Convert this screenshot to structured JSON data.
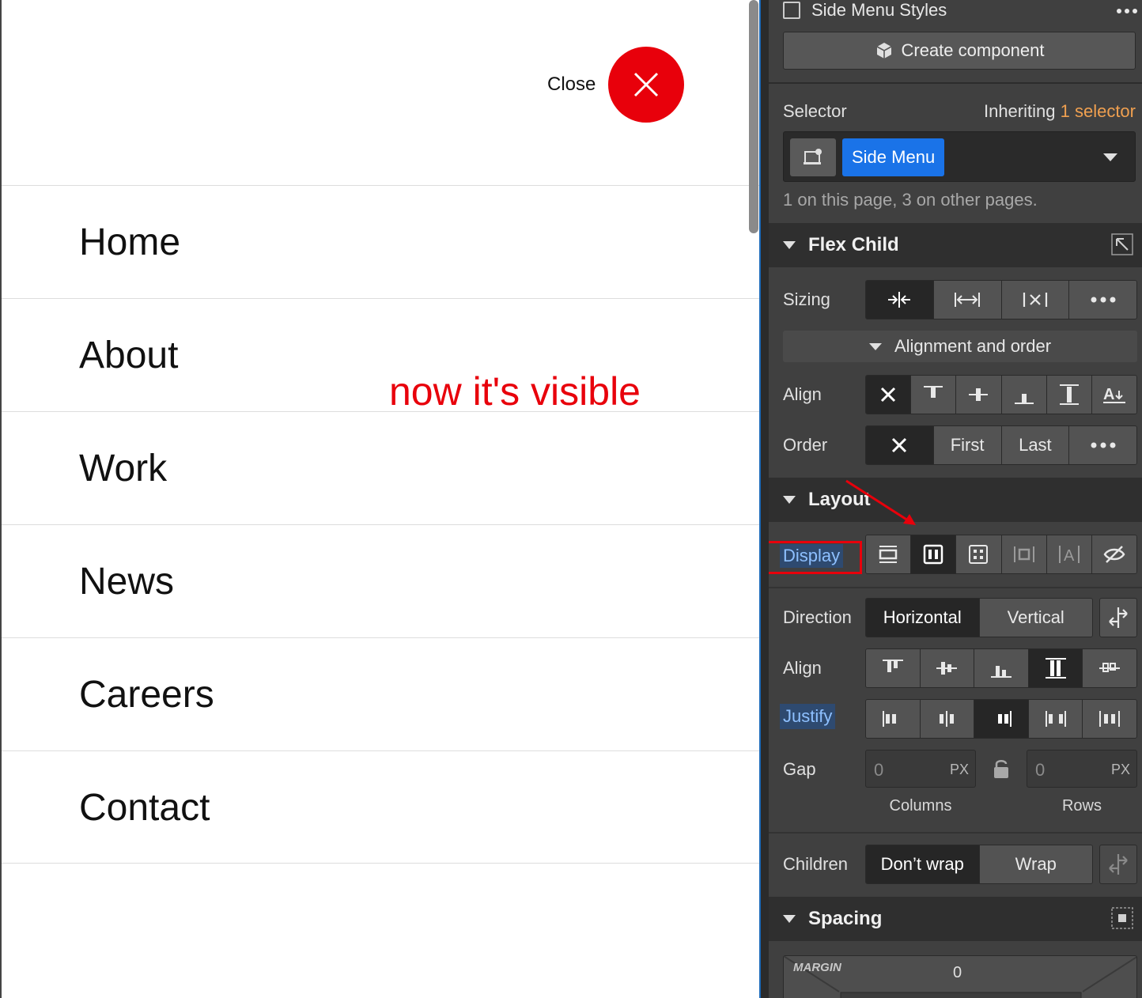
{
  "canvas": {
    "close_label": "Close",
    "nav_items": [
      "Home",
      "About",
      "Work",
      "News",
      "Careers",
      "Contact"
    ],
    "annotation": "now it's visible",
    "annotation_color": "#e8000b"
  },
  "panel": {
    "header": {
      "title": "Side Menu Styles",
      "more_icon": "more-horizontal-icon"
    },
    "create_component_label": "Create component",
    "selector": {
      "label": "Selector",
      "inheriting_text": "Inheriting",
      "inheriting_link": "1 selector",
      "tag": "Side Menu",
      "usage": "1 on this page, 3 on other pages."
    },
    "flex_child": {
      "title": "Flex Child",
      "sizing_label": "Sizing",
      "alignment_order_label": "Alignment and order",
      "align_label": "Align",
      "order_label": "Order",
      "order_options": [
        "First",
        "Last"
      ]
    },
    "layout": {
      "title": "Layout",
      "display_label": "Display",
      "direction_label": "Direction",
      "direction_options": [
        "Horizontal",
        "Vertical"
      ],
      "align_label": "Align",
      "justify_label": "Justify",
      "gap_label": "Gap",
      "gap_columns_value": "0",
      "gap_rows_value": "0",
      "gap_unit": "PX",
      "columns_label": "Columns",
      "rows_label": "Rows",
      "children_label": "Children",
      "children_options": [
        "Don’t wrap",
        "Wrap"
      ]
    },
    "spacing": {
      "title": "Spacing",
      "margin_label": "MARGIN",
      "margin_top_value": "0"
    },
    "colors": {
      "accent": "#1a73e8",
      "inherit_link": "#f0a050",
      "highlight_box": "#e8000b"
    }
  }
}
